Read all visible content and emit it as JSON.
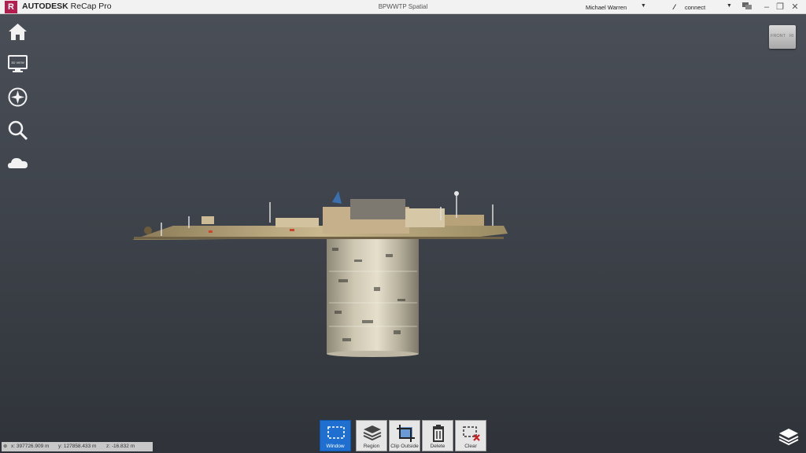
{
  "titlebar": {
    "logo_letter": "R",
    "brand": "AUTODESK",
    "product": "ReCap Pro",
    "document": "BPWWTP Spatial",
    "user": "Michael Warren",
    "connect": "connect"
  },
  "navcube": {
    "front": "FRONT",
    "right": "RI"
  },
  "sidebar": {
    "items": [
      {
        "icon": "home-icon"
      },
      {
        "icon": "monitor-icon",
        "text": "3D VIEW"
      },
      {
        "icon": "compass-icon"
      },
      {
        "icon": "search-icon"
      },
      {
        "icon": "cloud-icon"
      }
    ]
  },
  "toolbar": {
    "tools": [
      {
        "label": "Window",
        "icon": "window-select-icon",
        "active": true
      },
      {
        "label": "Region",
        "icon": "region-layers-icon"
      },
      {
        "label": "Clip Outside",
        "icon": "clip-outside-icon"
      },
      {
        "label": "Delete",
        "icon": "trash-icon"
      },
      {
        "label": "Clear",
        "icon": "clear-selection-icon"
      }
    ]
  },
  "statusbar": {
    "x": "x:  397726.909 m",
    "y": "y:  127858.433 m",
    "z": "z:  -16.832 m"
  },
  "colors": {
    "active_tool": "#1e6fd0",
    "brand_logo": "#b21f4e"
  }
}
